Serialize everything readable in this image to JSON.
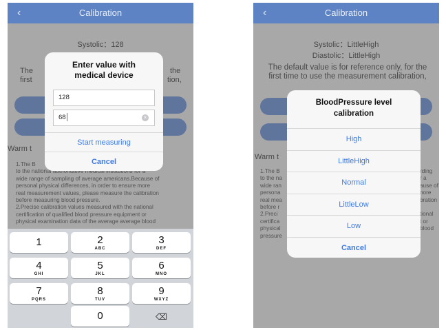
{
  "left_screen": {
    "nav": {
      "back_icon": "‹",
      "title": "Calibration"
    },
    "background": {
      "systolic_line": "Systolic：128",
      "fragment_left": "The",
      "fragment_left2": "first",
      "fragment_right": "the",
      "fragment_right2": "tion,",
      "warm": "Warm t",
      "body_lines": [
        "1.The B                                                                 ording",
        "to the national authoritative medical institutions for a",
        "wide range of sampling of average americans.Because of",
        "personal physical differences, in order to ensure more",
        "real measurement values, please measure the calibration",
        "before measuring blood pressure.",
        "2.Precise calibration values measured with the national",
        "certification of qualified blood pressure equipment or",
        "physical examination data of the average average blood"
      ]
    },
    "dialog": {
      "title_line1": "Enter value with",
      "title_line2": "medical device",
      "systolic_value": "128",
      "diastolic_value": "68",
      "start_label": "Start measuring",
      "cancel_label": "Cancel"
    },
    "keypad": {
      "keys": [
        {
          "num": "1",
          "letters": ""
        },
        {
          "num": "2",
          "letters": "ABC"
        },
        {
          "num": "3",
          "letters": "DEF"
        },
        {
          "num": "4",
          "letters": "GHI"
        },
        {
          "num": "5",
          "letters": "JKL"
        },
        {
          "num": "6",
          "letters": "MNO"
        },
        {
          "num": "7",
          "letters": "PQRS"
        },
        {
          "num": "8",
          "letters": "TUV"
        },
        {
          "num": "9",
          "letters": "WXYZ"
        }
      ],
      "zero": "0",
      "delete_icon": "⌫"
    }
  },
  "right_screen": {
    "nav": {
      "back_icon": "‹",
      "title": "Calibration"
    },
    "background": {
      "systolic_line": "Systolic：LittleHigh",
      "diastolic_line": "Diastolic：LittleHigh",
      "default_line1": "The default value is for reference only, for the",
      "default_line2": "first time to use the measurement calibration,",
      "warm": "Warm t",
      "left_frags": [
        "1.The B",
        "to the na",
        "wide ran",
        "persona",
        "real mea",
        "before r",
        "2.Preci",
        "certifica",
        "physical",
        "pressure"
      ],
      "right_frags": [
        "rding",
        "r a",
        "ause of",
        "nore",
        "bration",
        "",
        "tional",
        "t or",
        "blood"
      ]
    },
    "sheet": {
      "title_line1": "BloodPressure level",
      "title_line2": "calibration",
      "options": [
        "High",
        "LittleHigh",
        "Normal",
        "LittleLow",
        "Low"
      ],
      "cancel_label": "Cancel"
    }
  }
}
